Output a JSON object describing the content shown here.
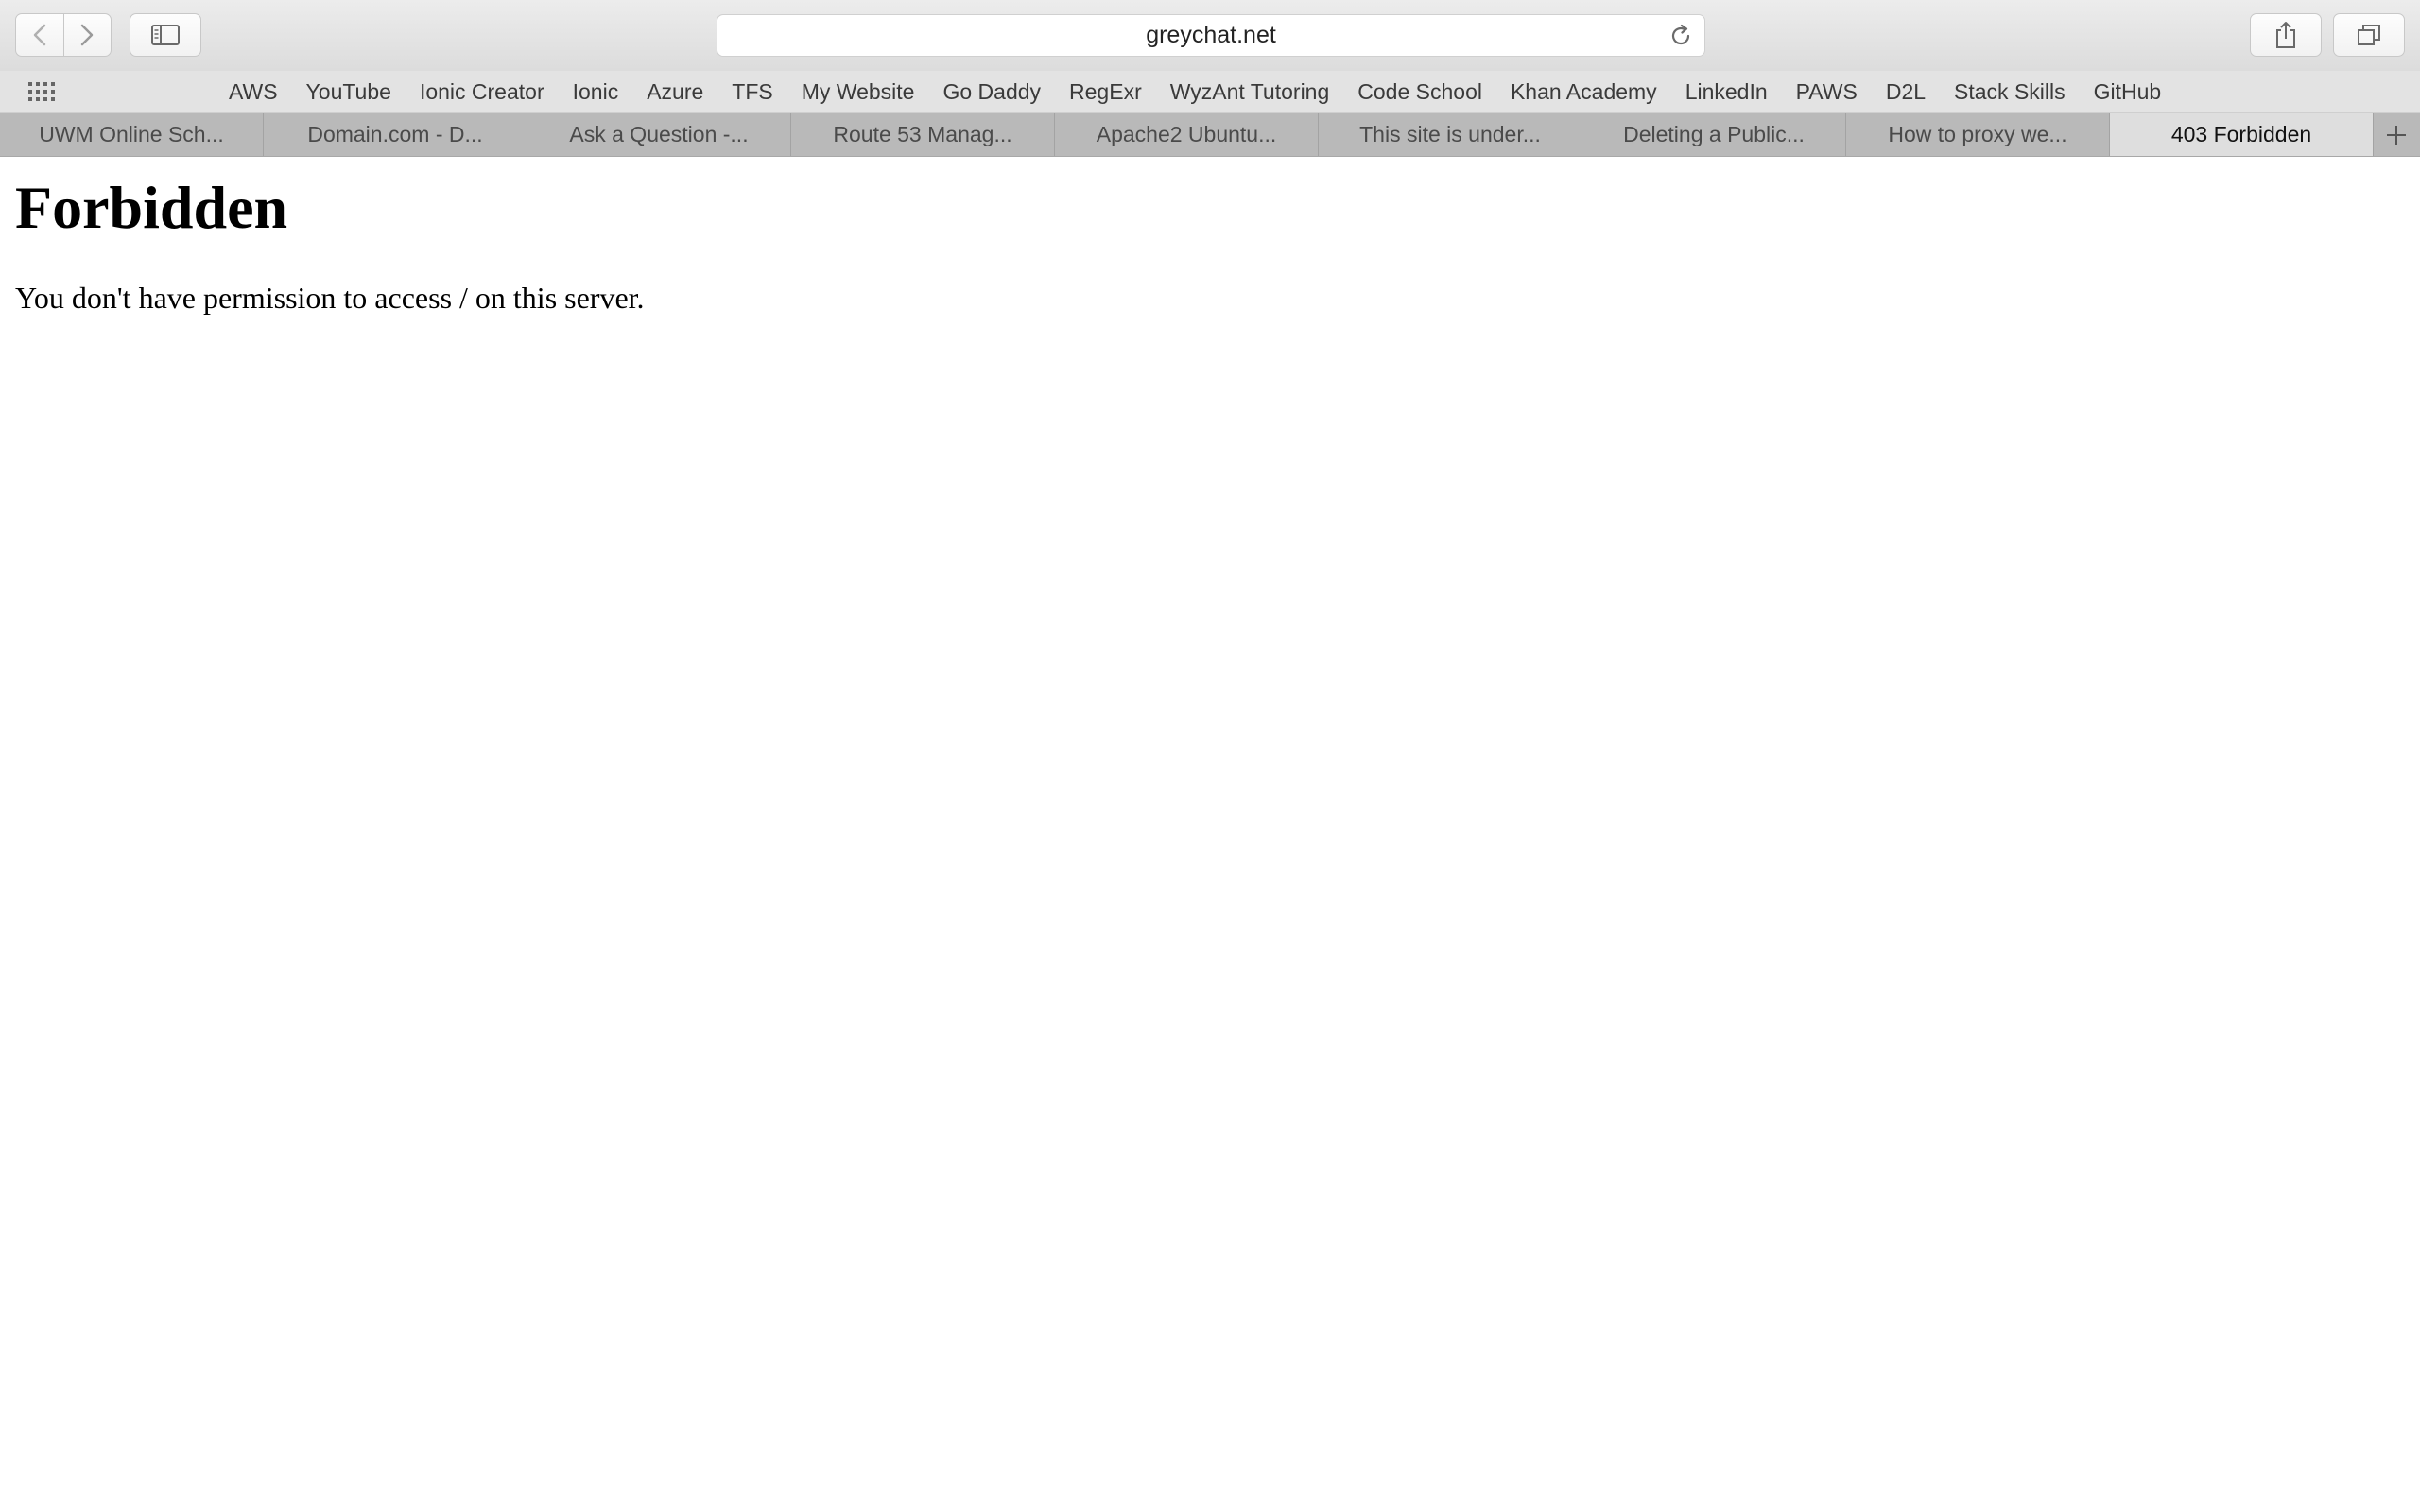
{
  "toolbar": {
    "url": "greychat.net",
    "back_icon": "chevron-left-icon",
    "forward_icon": "chevron-right-icon",
    "sidebar_icon": "sidebar-icon",
    "reload_icon": "reload-icon",
    "share_icon": "share-icon",
    "tabs_icon": "tabs-overview-icon"
  },
  "bookmarks": [
    {
      "label": "AWS"
    },
    {
      "label": "YouTube"
    },
    {
      "label": "Ionic Creator"
    },
    {
      "label": "Ionic"
    },
    {
      "label": "Azure"
    },
    {
      "label": "TFS"
    },
    {
      "label": "My Website"
    },
    {
      "label": "Go Daddy"
    },
    {
      "label": "RegExr"
    },
    {
      "label": "WyzAnt Tutoring"
    },
    {
      "label": "Code School"
    },
    {
      "label": "Khan Academy"
    },
    {
      "label": "LinkedIn"
    },
    {
      "label": "PAWS"
    },
    {
      "label": "D2L"
    },
    {
      "label": "Stack Skills"
    },
    {
      "label": "GitHub"
    }
  ],
  "tabs": [
    {
      "label": "UWM Online Sch...",
      "active": false
    },
    {
      "label": "Domain.com - D...",
      "active": false
    },
    {
      "label": "Ask a Question -...",
      "active": false
    },
    {
      "label": "Route 53 Manag...",
      "active": false
    },
    {
      "label": "Apache2 Ubuntu...",
      "active": false
    },
    {
      "label": "This site is under...",
      "active": false
    },
    {
      "label": "Deleting a Public...",
      "active": false
    },
    {
      "label": "How to proxy we...",
      "active": false
    },
    {
      "label": "403 Forbidden",
      "active": true
    }
  ],
  "page": {
    "heading": "Forbidden",
    "message": "You don't have permission to access / on this server."
  }
}
